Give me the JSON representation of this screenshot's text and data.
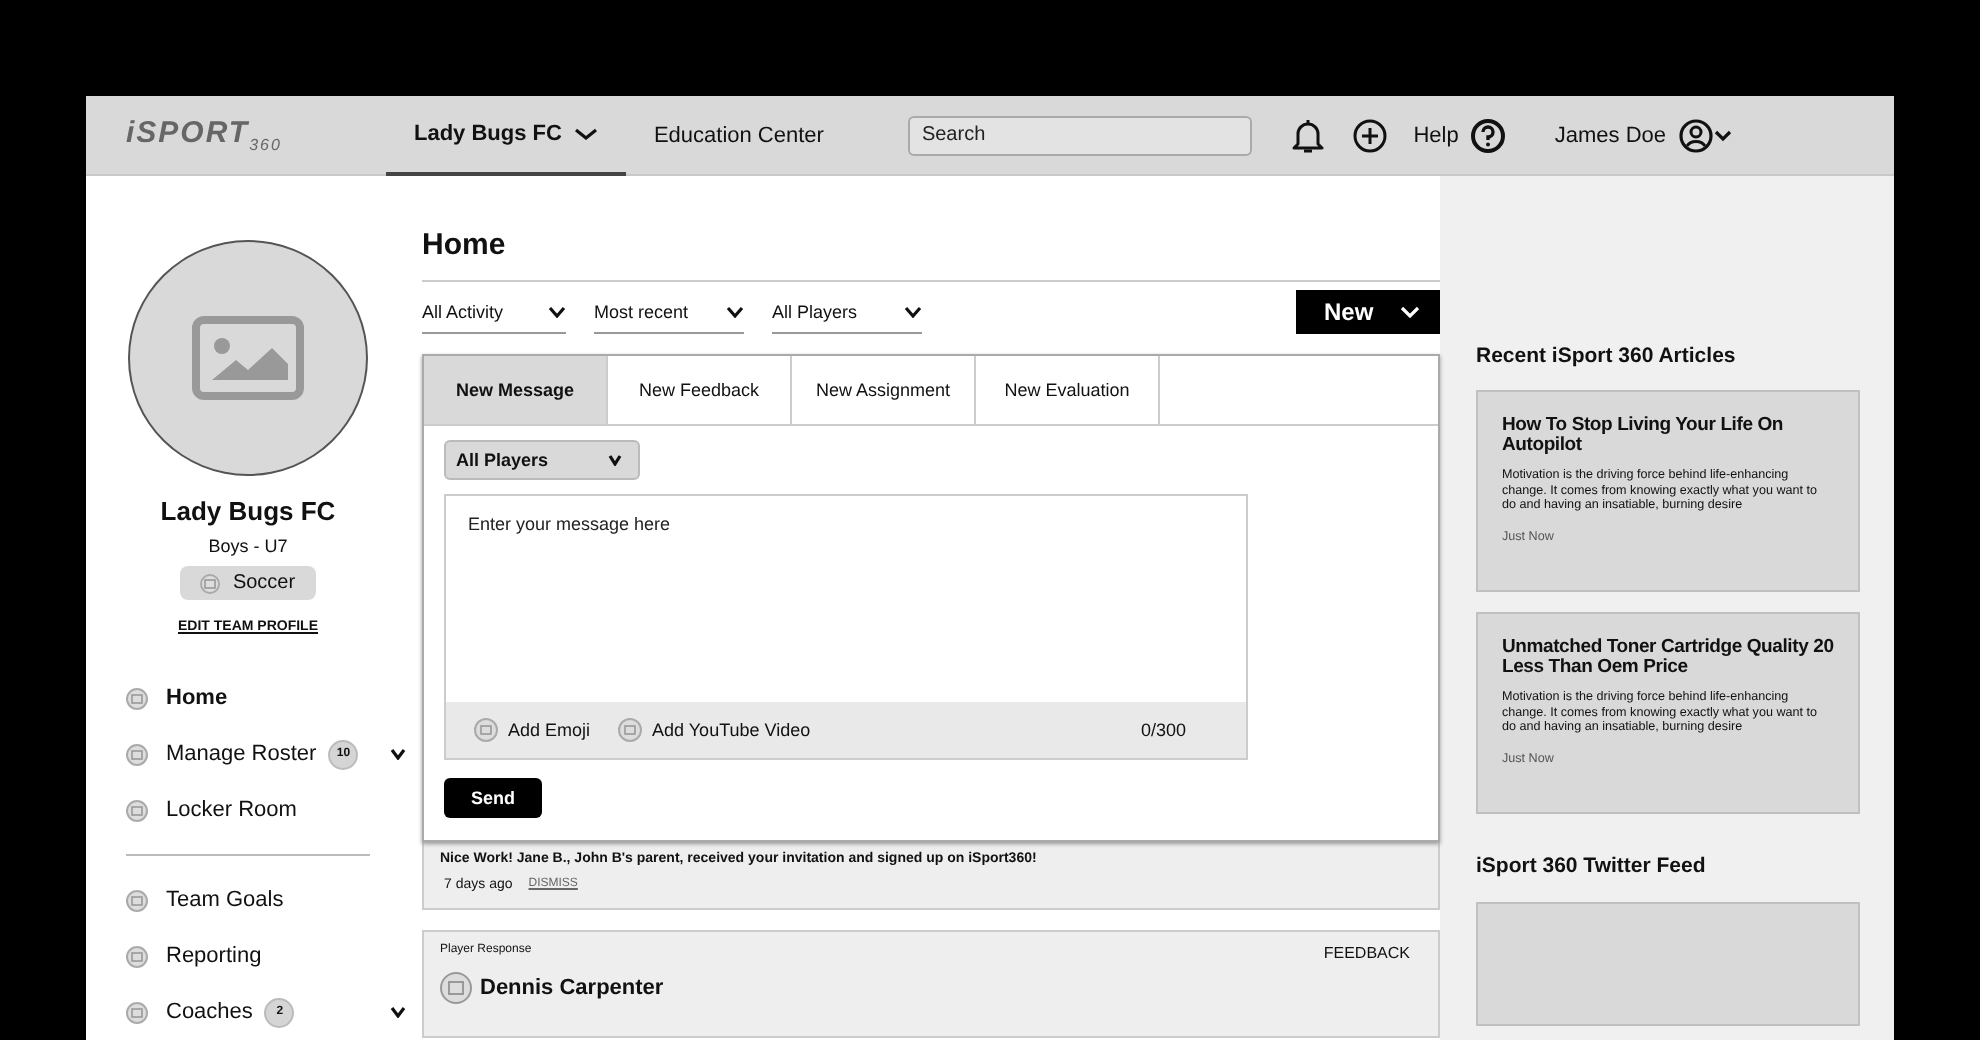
{
  "topbar": {
    "logo": "iSPORT$_{360}$",
    "nav": [
      {
        "label": "Lady Bugs FC",
        "selected": true,
        "dropdown": true
      },
      {
        "label": "Education Center",
        "selected": false,
        "dropdown": false
      }
    ],
    "search": {
      "placeholder": "Search"
    },
    "help": "Help",
    "user": "James Doe"
  },
  "team": {
    "name": "Lady Bugs FC",
    "division": "Boys - U7",
    "sport": "Soccer",
    "edit_link": "EDIT TEAM PROFILE"
  },
  "sidebar": {
    "groups": [
      [
        {
          "label": "Home",
          "selected": true
        },
        {
          "label": "Manage Roster",
          "selected": false,
          "badge": "10",
          "dropdown": true
        },
        {
          "label": "Locker Room",
          "selected": false
        }
      ],
      [
        {
          "label": "Team Goals",
          "selected": false
        },
        {
          "label": "Reporting",
          "selected": false
        },
        {
          "label": "Coaches",
          "selected": false,
          "badge": "2",
          "dropdown": true
        }
      ]
    ]
  },
  "main": {
    "title": "Home",
    "filters": [
      "All Activity",
      "Most recent",
      "All Players"
    ],
    "new_button": "New",
    "composer": {
      "tabs": [
        {
          "label": "New Message",
          "selected": true
        },
        {
          "label": "New Feedback",
          "selected": false
        },
        {
          "label": "New Assignment",
          "selected": false
        },
        {
          "label": "New Evaluation",
          "selected": false
        }
      ],
      "recipient": "All Players",
      "message": {
        "placeholder": "Enter your message here"
      },
      "actions": [
        "Add Emoji",
        "Add YouTube Video"
      ],
      "counter": "0/300",
      "send": "Send"
    },
    "notification": {
      "text": "Nice Work!  Jane B., John B's parent, received your invitation and signed up on iSport360!",
      "time": "7 days ago",
      "dismiss": "DISMISS"
    },
    "post": {
      "type": "Player Response",
      "tag": "FEEDBACK",
      "author": "Dennis Carpenter"
    }
  },
  "right_panel": {
    "articles_title": "Recent iSport 360 Articles",
    "articles": [
      {
        "title": "How To Stop Living Your Life On Autopilot",
        "body": "Motivation is the driving force behind life-enhancing change. It comes from knowing exactly what you want to do and having an insatiable, burning desire",
        "time": "Just Now"
      },
      {
        "title": "Unmatched Toner Cartridge Quality 20 Less Than Oem Price",
        "body": "Motivation is the driving force behind life-enhancing change. It comes from knowing exactly what you want to do and having an insatiable, burning desire",
        "time": "Just Now"
      }
    ],
    "twitter_title": "iSport 360 Twitter Feed"
  }
}
